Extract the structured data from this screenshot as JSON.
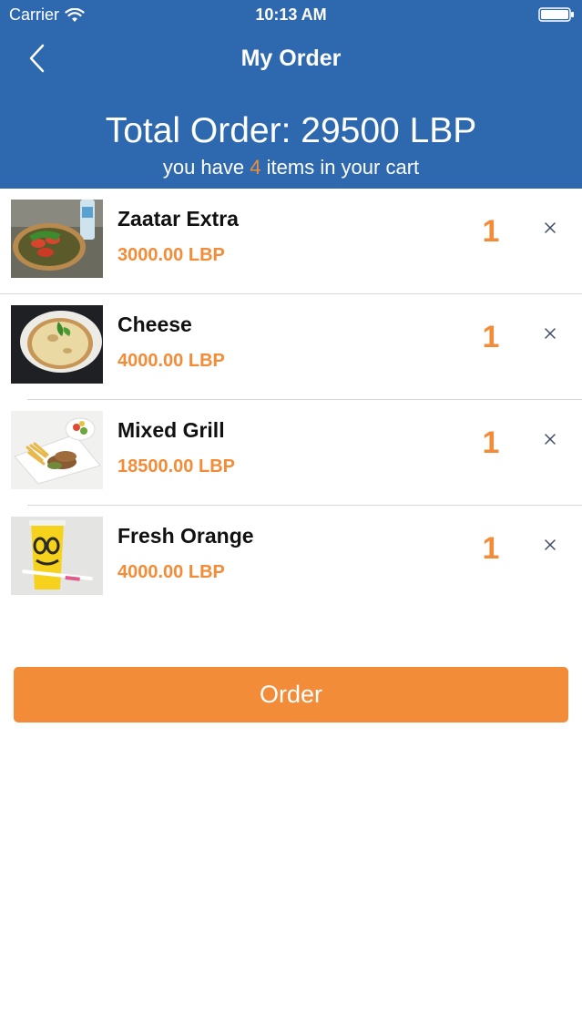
{
  "status_bar": {
    "carrier": "Carrier",
    "time": "10:13 AM",
    "wifi_icon": "wifi-icon",
    "battery_icon": "battery-icon"
  },
  "nav": {
    "title": "My Order",
    "back_icon": "chevron-left-icon"
  },
  "summary": {
    "total_text": "Total Order: 29500 LBP",
    "cart_prefix": "you have",
    "cart_count": "4",
    "cart_suffix": "items in your cart"
  },
  "items": [
    {
      "name": "Zaatar Extra",
      "price": "3000.00 LBP",
      "qty": "1"
    },
    {
      "name": "Cheese",
      "price": "4000.00 LBP",
      "qty": "1"
    },
    {
      "name": "Mixed Grill",
      "price": "18500.00 LBP",
      "qty": "1"
    },
    {
      "name": "Fresh Orange",
      "price": "4000.00 LBP",
      "qty": "1"
    }
  ],
  "order_button": {
    "label": "Order"
  },
  "colors": {
    "header": "#2e69b0",
    "accent": "#f28c38",
    "divider": "#d6d6d6"
  }
}
